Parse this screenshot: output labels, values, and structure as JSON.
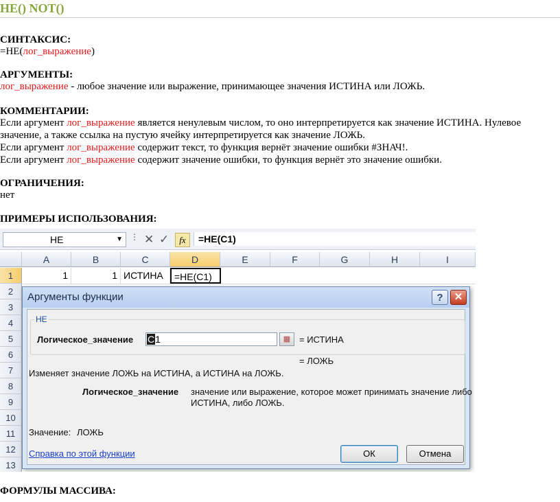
{
  "doc": {
    "title": "НЕ() NOT()",
    "syntax_heading": "СИНТАКСИС:",
    "syntax_prefix": "=НЕ(",
    "syntax_arg": "лог_выражение",
    "syntax_suffix": ")",
    "args_heading": "АРГУМЕНТЫ:",
    "args_arg": "лог_выражение",
    "args_text": " - любое значение или выражение, принимающее значения ИСТИНА или ЛОЖЬ.",
    "comments_heading": "КОММЕНТАРИИ:",
    "c1_a": "Если аргумент ",
    "c1_arg": "лог_выражение",
    "c1_b": " является ненулевым числом, то оно интерпретируется как значение ИСТИНА. Нулевое",
    "c1_c": "значение, а также ссылка на пустую ячейку интерпретируется как значение ЛОЖЬ.",
    "c2_a": "Если аргумент ",
    "c2_arg": "лог_выражение",
    "c2_b": " содержит текст, то функция вернёт значение ошибки #ЗНАЧ!.",
    "c3_a": "Если аргумент ",
    "c3_arg": "лог_выражение",
    "c3_b": " содержит значение ошибки, то функция вернёт это значение ошибки.",
    "limits_heading": "ОГРАНИЧЕНИЯ:",
    "limits_text": "нет",
    "examples_heading": "ПРИМЕРЫ ИСПОЛЬЗОВАНИЯ:",
    "array_heading": "ФОРМУЛЫ МАССИВА:"
  },
  "excel": {
    "name_box": "НЕ",
    "formula": "=НЕ(C1)",
    "fx_label": "fx",
    "columns": [
      "A",
      "B",
      "C",
      "D",
      "E",
      "F",
      "G",
      "H",
      "I"
    ],
    "rows": [
      "1",
      "2",
      "3",
      "4",
      "5",
      "6",
      "7",
      "8",
      "9",
      "10",
      "11",
      "12",
      "13"
    ],
    "cells": {
      "a1": "1",
      "b1": "1",
      "c1": "ИСТИНА",
      "d1": "=НЕ(C1)"
    },
    "dialog": {
      "title": "Аргументы функции",
      "help_glyph": "?",
      "close_glyph": "✕",
      "group_label": "НЕ",
      "arg_label": "Логическое_значение",
      "arg_value_sel": "C",
      "arg_value_rest": "1",
      "arg_result": "=  ИСТИНА",
      "fn_result": "=  ЛОЖЬ",
      "description": "Изменяет значение ЛОЖЬ на ИСТИНА, а ИСТИНА на ЛОЖЬ.",
      "arg_desc_label": "Логическое_значение",
      "arg_desc_1": "значение или выражение, которое может принимать значение либо",
      "arg_desc_2": "ИСТИНА, либо ЛОЖЬ.",
      "value_label": "Значение:",
      "value": "ЛОЖЬ",
      "help_link": "Справка по этой функции",
      "ok": "ОК",
      "cancel": "Отмена"
    }
  },
  "colors": {
    "title": "#86a53a",
    "arg": "#e21c1c",
    "link": "#1a3ec9"
  }
}
